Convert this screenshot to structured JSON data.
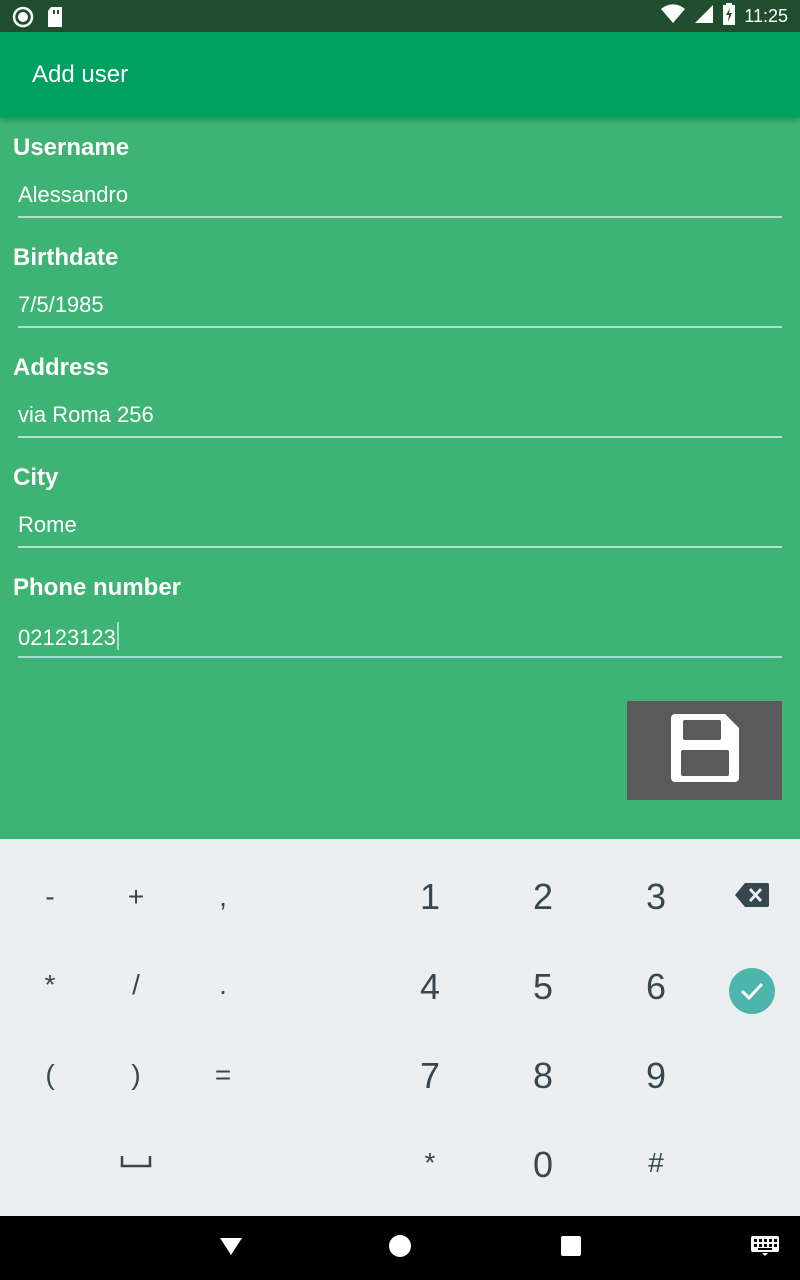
{
  "status_bar": {
    "time": "11:25",
    "icons": [
      "notification-circle-icon",
      "sd-card-icon",
      "wifi-icon",
      "signal-icon",
      "battery-charging-icon"
    ]
  },
  "app_bar": {
    "title": "Add user"
  },
  "form": {
    "fields": [
      {
        "label": "Username",
        "value": "Alessandro"
      },
      {
        "label": "Birthdate",
        "value": "7/5/1985"
      },
      {
        "label": "Address",
        "value": "via Roma 256"
      },
      {
        "label": "City",
        "value": "Rome"
      },
      {
        "label": "Phone number",
        "value": "02123123"
      }
    ],
    "save_icon": "floppy-disk-icon"
  },
  "keyboard": {
    "symbols": [
      "-",
      "+",
      ",",
      "*",
      "/",
      ".",
      "(",
      ")",
      "="
    ],
    "numbers": [
      "1",
      "2",
      "3",
      "4",
      "5",
      "6",
      "7",
      "8",
      "9",
      "*",
      "0",
      "#"
    ],
    "space_icon": "space-icon",
    "backspace_icon": "backspace-icon",
    "done_icon": "checkmark-icon"
  },
  "nav_bar": {
    "icons": [
      "back-icon",
      "home-icon",
      "recents-icon",
      "keyboard-switch-icon"
    ]
  },
  "colors": {
    "background": "#3db374",
    "app_bar": "#00a060",
    "status_bar": "#1f4d2e",
    "save_button": "#5a5a5a",
    "accent": "#4db6ac"
  }
}
